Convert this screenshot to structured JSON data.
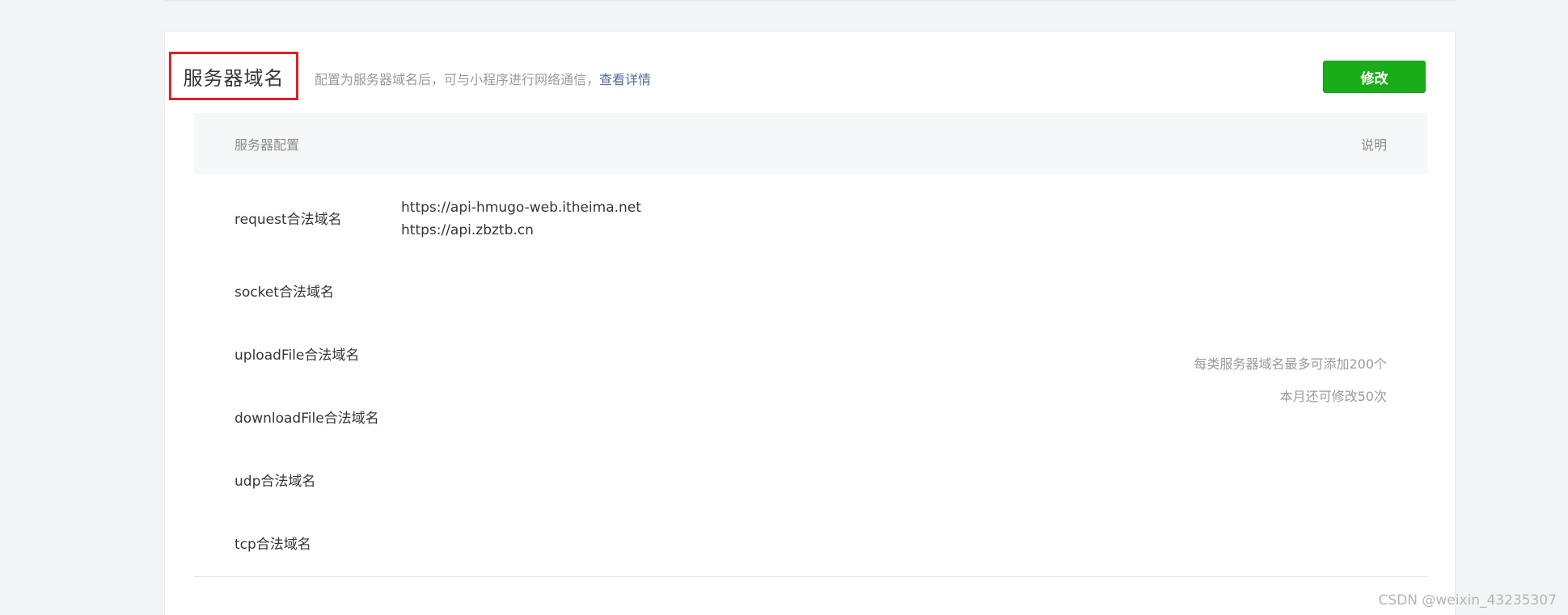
{
  "section": {
    "title": "服务器域名",
    "description": "配置为服务器域名后，可与小程序进行网络通信，",
    "details_link": "查看详情",
    "edit_button": "修改"
  },
  "table": {
    "header_left": "服务器配置",
    "header_right": "说明",
    "rows": [
      {
        "label": "request合法域名",
        "values": [
          "https://api-hmugo-web.itheima.net",
          "https://api.zbztb.cn"
        ]
      },
      {
        "label": "socket合法域名",
        "values": []
      },
      {
        "label": "uploadFile合法域名",
        "values": []
      },
      {
        "label": "downloadFile合法域名",
        "values": []
      },
      {
        "label": "udp合法域名",
        "values": []
      },
      {
        "label": "tcp合法域名",
        "values": []
      }
    ],
    "notes": [
      "每类服务器域名最多可添加200个",
      "本月还可修改50次"
    ]
  },
  "watermark": "CSDN @weixin_43235307",
  "colors": {
    "accent_green": "#1aad19",
    "link_blue": "#576b95",
    "highlight_red": "#e02020"
  }
}
